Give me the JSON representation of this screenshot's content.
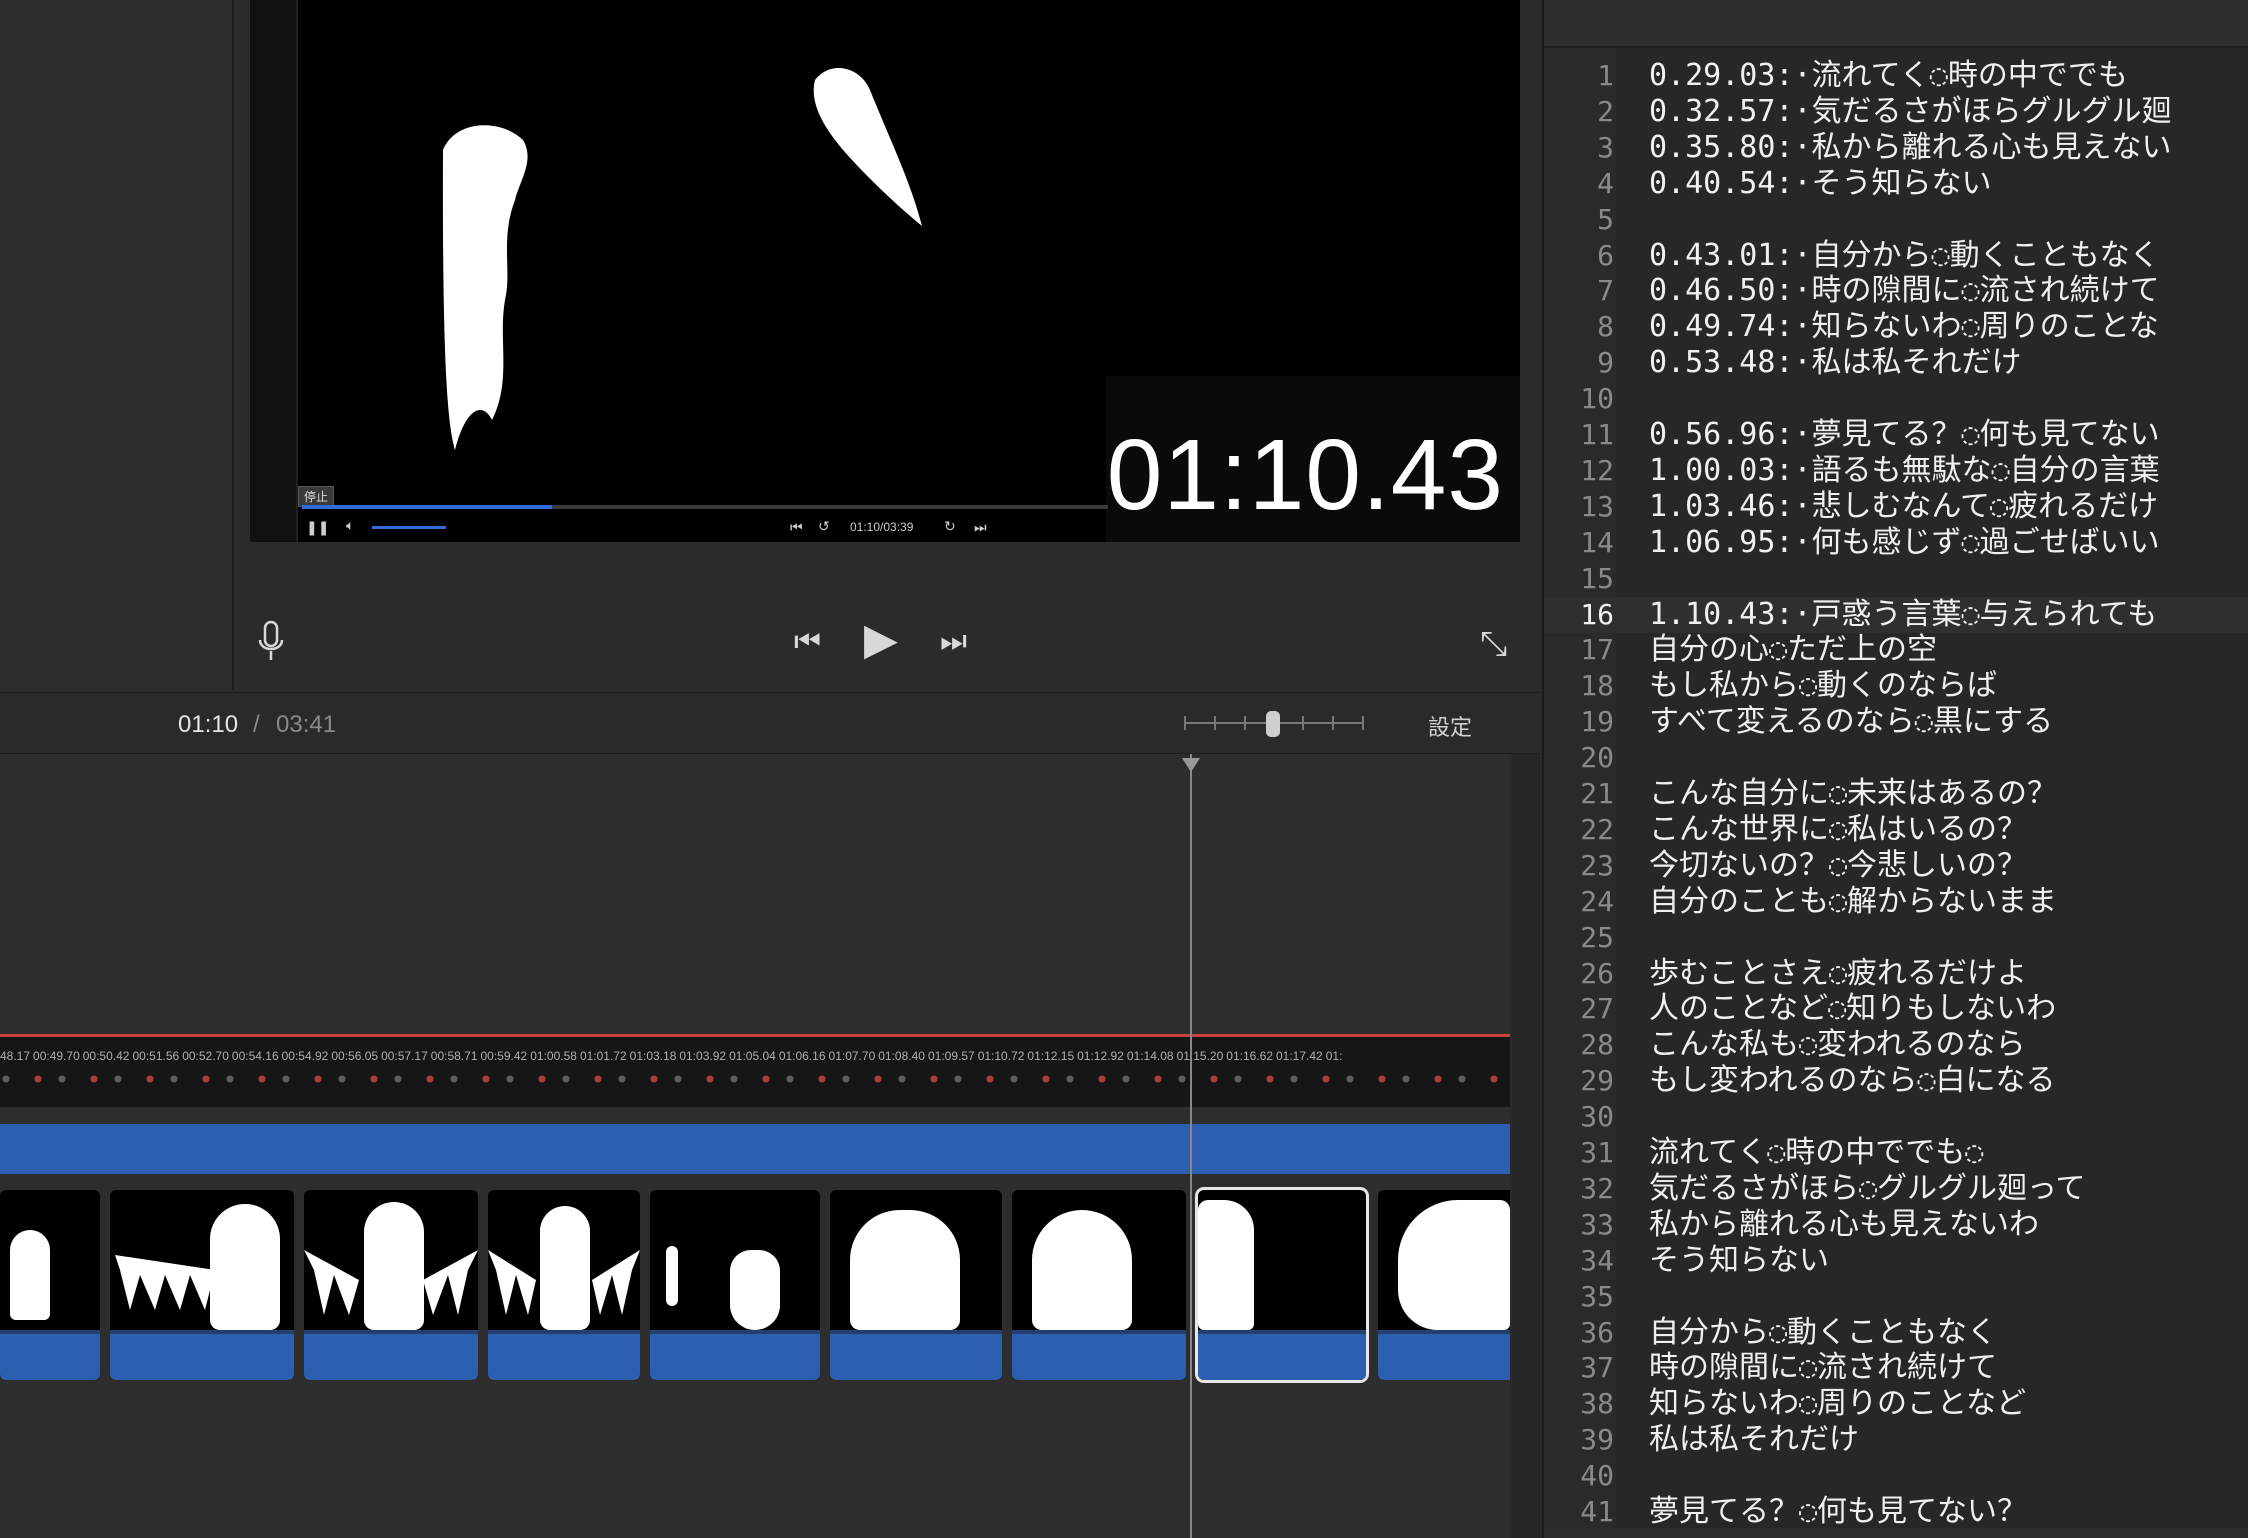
{
  "viewer": {
    "timecode_overlay": "01:10.43",
    "player_tooltip": "停止",
    "player_time": "01:10/03:39",
    "player_progress": 0.31
  },
  "toolbar": {
    "current_time": "01:10",
    "separator": "/",
    "total_time": "03:41",
    "settings_label": "設定"
  },
  "timeline": {
    "timestamps": [
      "48.17",
      "00:49.70",
      "00:50.42",
      "00:51.56",
      "00:52.70",
      "00:54.16",
      "00:54.92",
      "00:56.05",
      "00:57.17",
      "00:58.71",
      "00:59.42",
      "01:00.58",
      "01:01.72",
      "01:03.18",
      "01:03.92",
      "01:05.04",
      "01:06.16",
      "01:07.70",
      "01:08.40",
      "01:09.57",
      "01:10.72",
      "01:12.15",
      "01:12.92",
      "01:14.08",
      "01:15.20",
      "01:16.62",
      "01:17.42",
      "01:"
    ]
  },
  "editor": {
    "current_line": 16,
    "lines": [
      "0.29.03:·流れてく◌時の中ででも",
      "0.32.57:·気だるさがほらグルグル廻",
      "0.35.80:·私から離れる心も見えない",
      "0.40.54:·そう知らない",
      "",
      "0.43.01:·自分から◌動くこともなく",
      "0.46.50:·時の隙間に◌流され続けて",
      "0.49.74:·知らないわ◌周りのことな",
      "0.53.48:·私は私それだけ",
      "",
      "0.56.96:·夢見てる？◌何も見てない",
      "1.00.03:·語るも無駄な◌自分の言葉",
      "1.03.46:·悲しむなんて◌疲れるだけ",
      "1.06.95:·何も感じず◌過ごせばいい",
      "",
      "1.10.43:·戸惑う言葉◌与えられても",
      "自分の心◌ただ上の空",
      "もし私から◌動くのならば",
      "すべて変えるのなら◌黒にする",
      "",
      "こんな自分に◌未来はあるの？",
      "こんな世界に◌私はいるの？",
      "今切ないの？◌今悲しいの？",
      "自分のことも◌解からないまま",
      "",
      "歩むことさえ◌疲れるだけよ",
      "人のことなど◌知りもしないわ",
      "こんな私も◌変われるのなら",
      "もし変われるのなら◌白になる",
      "",
      "流れてく◌時の中ででも◌",
      "気だるさがほら◌グルグル廻って",
      "私から離れる心も見えないわ",
      "そう知らない",
      "",
      "自分から◌動くこともなく",
      "時の隙間に◌流され続けて",
      "知らないわ◌周りのことなど",
      "私は私それだけ",
      "",
      "夢見てる？◌何も見てない？"
    ]
  },
  "colors": {
    "accent_blue": "#2d5fb0",
    "progress_blue": "#2f6cd9",
    "audio_red": "#c9403d"
  }
}
